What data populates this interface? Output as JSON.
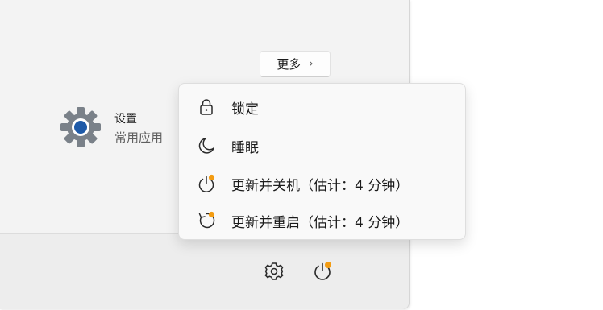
{
  "start_menu": {
    "more_button": {
      "label": "更多",
      "chevron": "›"
    },
    "app": {
      "name": "设置",
      "subtitle": "常用应用",
      "icon": "settings-gear-icon"
    }
  },
  "power_menu": {
    "items": [
      {
        "label": "锁定",
        "icon": "lock-icon"
      },
      {
        "label": "睡眠",
        "icon": "moon-icon"
      },
      {
        "label": "更新并关机（估计：4 分钟）",
        "icon": "power-update-icon"
      },
      {
        "label": "更新并重启（估计：4 分钟）",
        "icon": "restart-update-icon"
      }
    ]
  },
  "footer": {
    "icons": [
      "settings-icon",
      "power-update-icon"
    ]
  },
  "colors": {
    "update_badge": "#f39c12",
    "panel_bg": "#f3f3f3",
    "menu_bg": "#f9f9f9",
    "gear_blue": "#1e5aa8"
  }
}
